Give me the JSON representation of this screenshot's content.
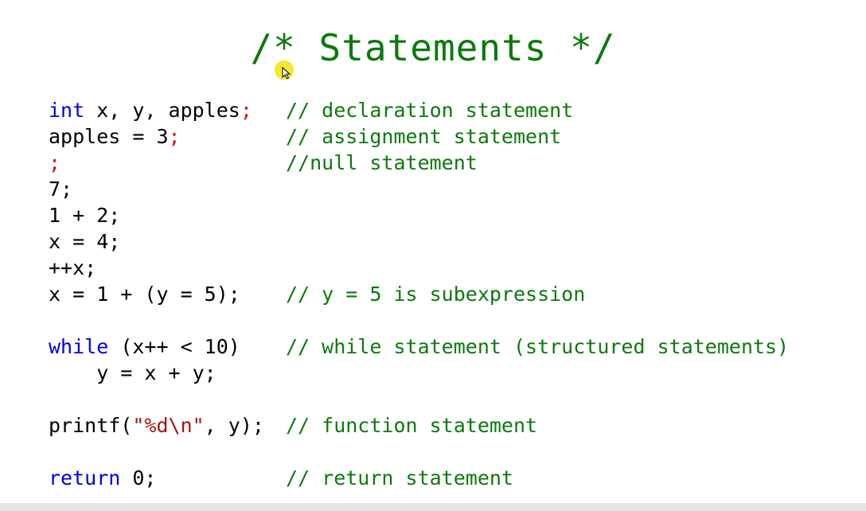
{
  "title": "/* Statements */",
  "lines": [
    {
      "code": [
        {
          "t": "int",
          "c": "kw"
        },
        {
          "t": " x, y, apples",
          "c": ""
        },
        {
          "t": ";",
          "c": "semi-red"
        }
      ],
      "comment": "// declaration statement"
    },
    {
      "code": [
        {
          "t": "apples = 3",
          "c": ""
        },
        {
          "t": ";",
          "c": "semi-red"
        }
      ],
      "comment": "// assignment statement"
    },
    {
      "code": [
        {
          "t": ";",
          "c": "semi-red"
        }
      ],
      "comment": "//null statement"
    },
    {
      "code": [
        {
          "t": "7;",
          "c": ""
        }
      ],
      "comment": ""
    },
    {
      "code": [
        {
          "t": "1 + 2;",
          "c": ""
        }
      ],
      "comment": ""
    },
    {
      "code": [
        {
          "t": "x = 4;",
          "c": ""
        }
      ],
      "comment": ""
    },
    {
      "code": [
        {
          "t": "++x;",
          "c": ""
        }
      ],
      "comment": ""
    },
    {
      "code": [
        {
          "t": "x = 1 + (y = 5);",
          "c": ""
        }
      ],
      "comment": "// y = 5 is subexpression"
    },
    {
      "blank": true
    },
    {
      "code": [
        {
          "t": "while",
          "c": "kw"
        },
        {
          "t": " (x++ < 10)",
          "c": ""
        }
      ],
      "comment": "// while statement (structured statements)"
    },
    {
      "code": [
        {
          "t": "    y = x + y;",
          "c": ""
        }
      ],
      "comment": ""
    },
    {
      "blank": true
    },
    {
      "code": [
        {
          "t": "printf(",
          "c": ""
        },
        {
          "t": "\"%d\\n\"",
          "c": "str"
        },
        {
          "t": ", y);",
          "c": ""
        }
      ],
      "comment": "// function statement"
    },
    {
      "blank": true
    },
    {
      "code": [
        {
          "t": "return",
          "c": "kw"
        },
        {
          "t": " 0;",
          "c": ""
        }
      ],
      "comment": "// return statement"
    }
  ],
  "colors": {
    "keyword": "#0000dd",
    "comment": "#0b7a0b",
    "semicolon_highlight": "#dd1111",
    "string": "#a31515"
  }
}
